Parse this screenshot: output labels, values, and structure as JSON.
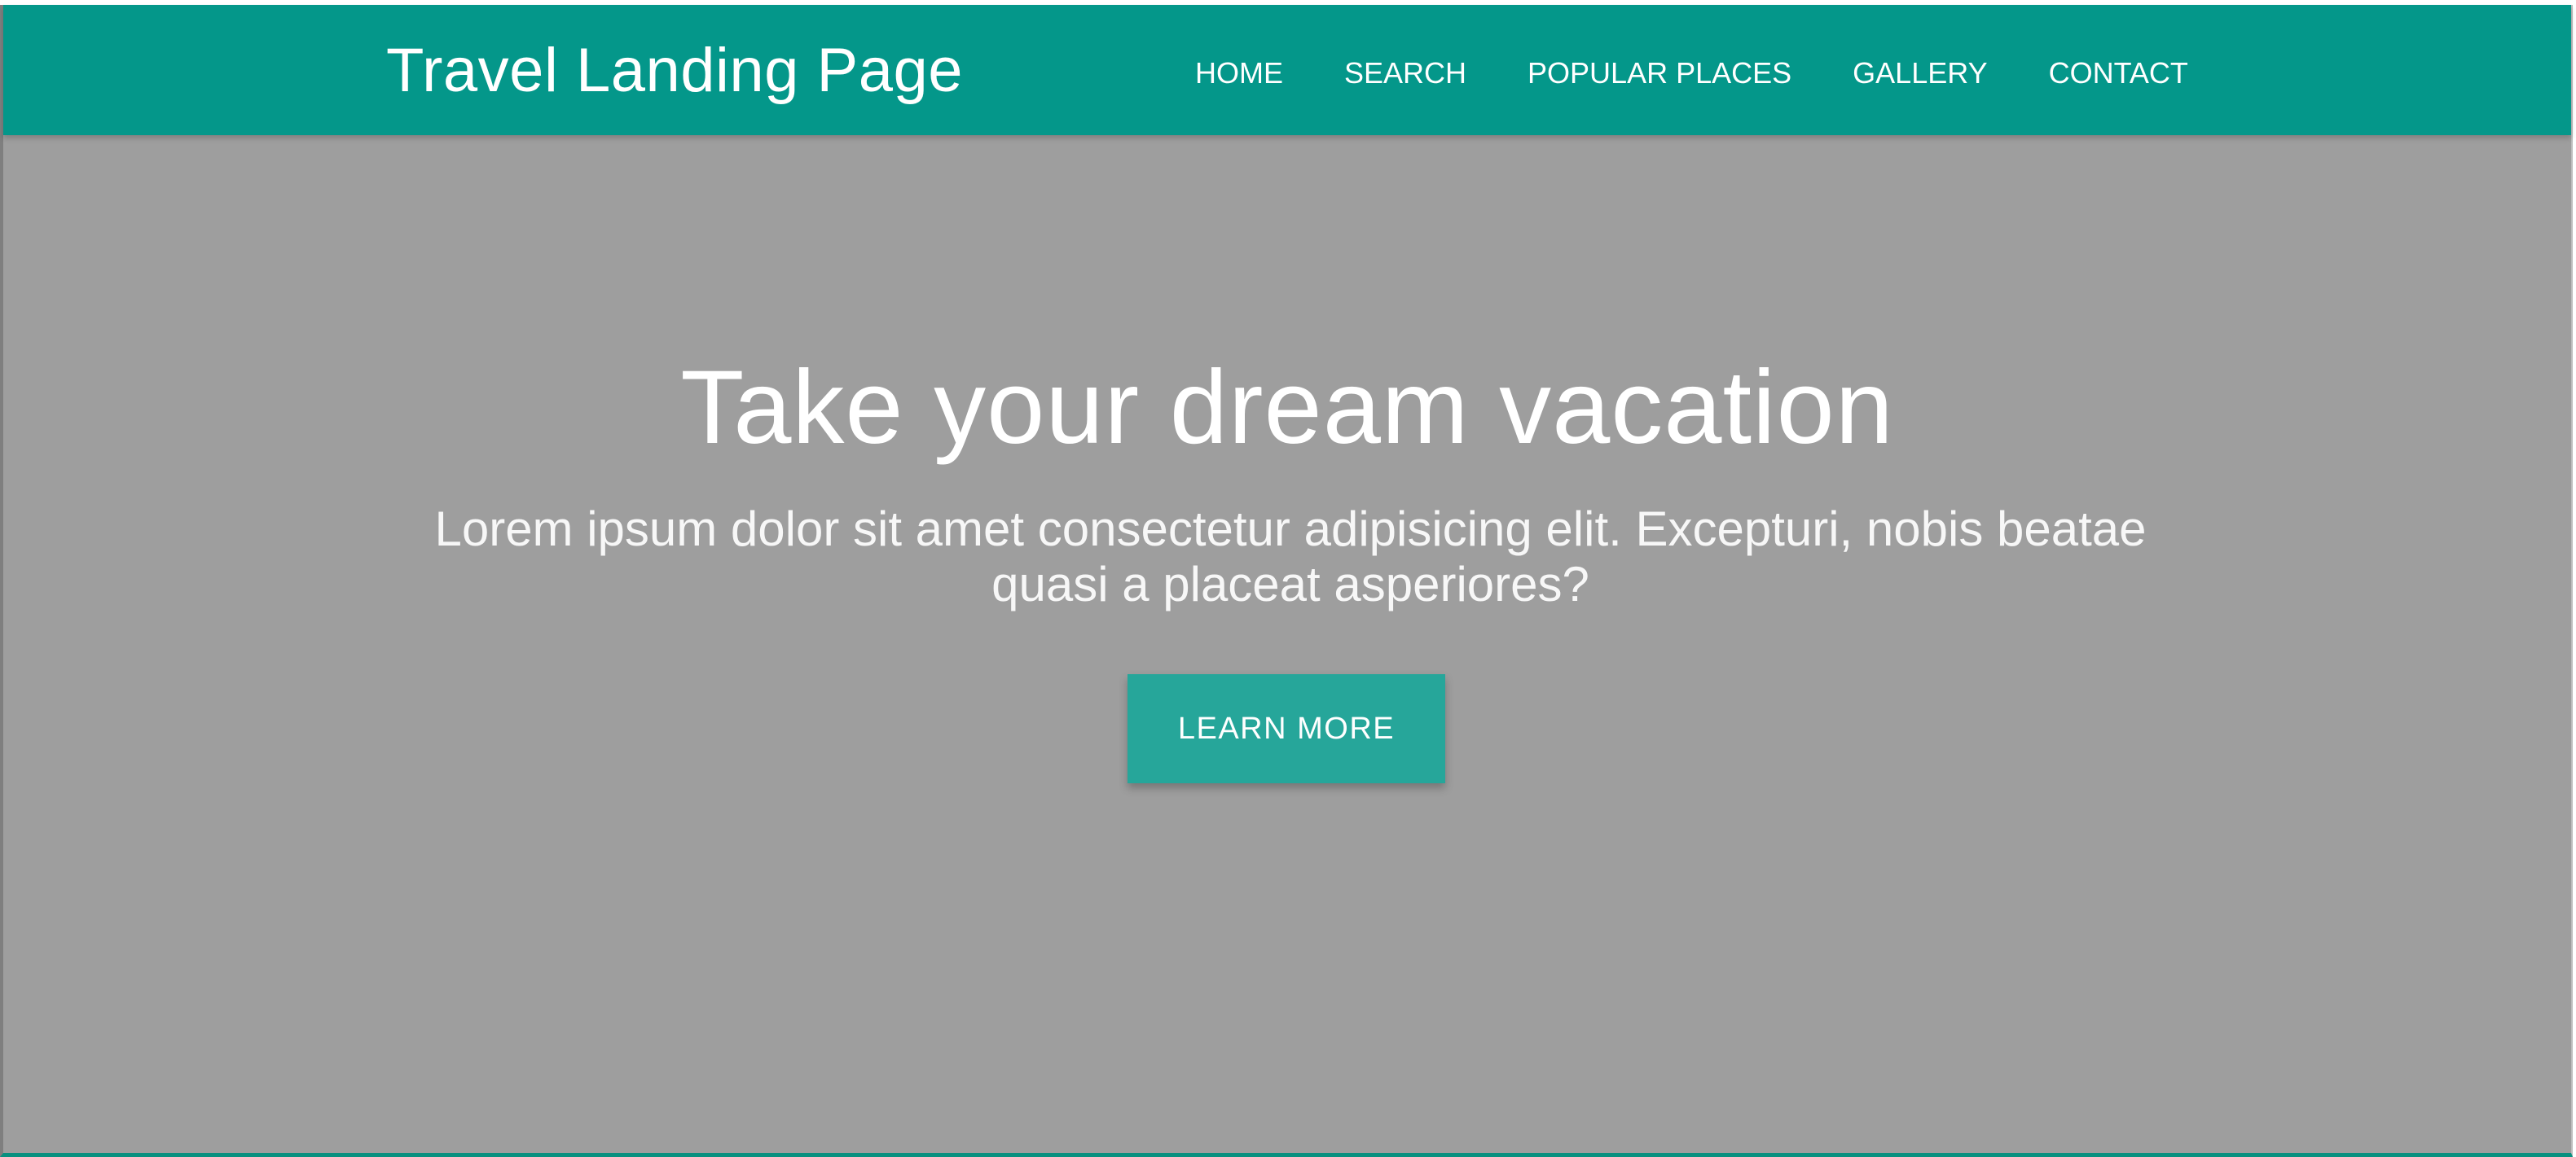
{
  "header": {
    "brand": "Travel Landing Page",
    "nav": [
      {
        "label": "HOME"
      },
      {
        "label": "SEARCH"
      },
      {
        "label": "POPULAR PLACES"
      },
      {
        "label": "GALLERY"
      },
      {
        "label": "CONTACT"
      }
    ]
  },
  "hero": {
    "title": "Take your dream vacation",
    "text": "Lorem ipsum dolor sit amet consectetur adipisicing elit. Excepturi, nobis beatae quasi a placeat asperiores?",
    "button_label": "LEARN MORE"
  },
  "colors": {
    "nav_bg": "#04978a",
    "hero_bg": "#9e9e9e",
    "button_bg": "#26a69a",
    "text": "#ffffff"
  }
}
